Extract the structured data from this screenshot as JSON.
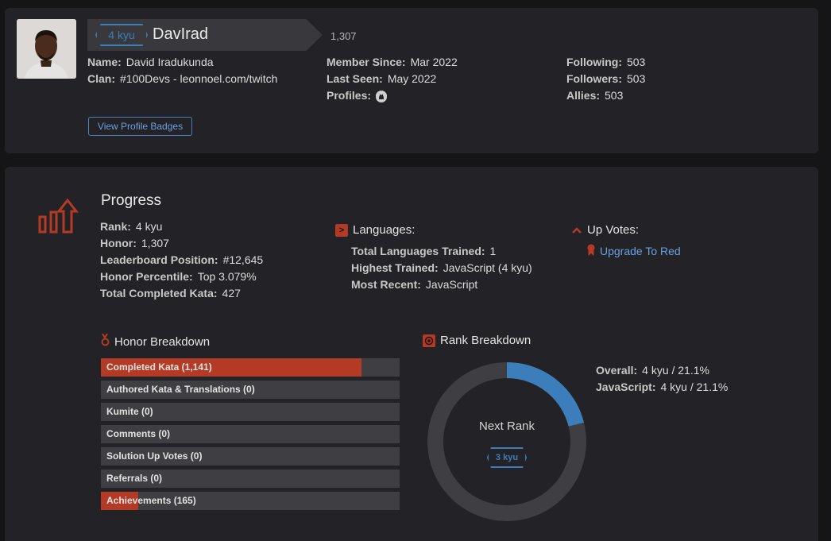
{
  "profile": {
    "rank_badge": "4 kyu",
    "username": "DavIrad",
    "honor": "1,307",
    "name_label": "Name:",
    "name_value": "David Iradukunda",
    "clan_label": "Clan:",
    "clan_value": "#100Devs - leonnoel.com/twitch",
    "member_since_label": "Member Since:",
    "member_since_value": "Mar 2022",
    "last_seen_label": "Last Seen:",
    "last_seen_value": "May 2022",
    "profiles_label": "Profiles:",
    "following_label": "Following:",
    "following_value": "503",
    "followers_label": "Followers:",
    "followers_value": "503",
    "allies_label": "Allies:",
    "allies_value": "503",
    "badges_button": "View Profile Badges"
  },
  "progress": {
    "title": "Progress",
    "rank_label": "Rank:",
    "rank_value": "4 kyu",
    "honor_label": "Honor:",
    "honor_value": "1,307",
    "leaderboard_label": "Leaderboard Position:",
    "leaderboard_value": "#12,645",
    "percentile_label": "Honor Percentile:",
    "percentile_value": "Top 3.079%",
    "kata_label": "Total Completed Kata:",
    "kata_value": "427"
  },
  "languages": {
    "title": "Languages:",
    "total_label": "Total Languages Trained:",
    "total_value": "1",
    "highest_label": "Highest Trained:",
    "highest_value": "JavaScript (4 kyu)",
    "recent_label": "Most Recent:",
    "recent_value": "JavaScript"
  },
  "upvotes": {
    "title": "Up Votes:",
    "link": "Upgrade To Red"
  },
  "honor_breakdown": {
    "title": "Honor Breakdown",
    "bars": [
      {
        "label": "Completed Kata (1,141)",
        "fraction": 0.873
      },
      {
        "label": "Authored Kata & Translations (0)",
        "fraction": 0
      },
      {
        "label": "Kumite (0)",
        "fraction": 0
      },
      {
        "label": "Comments (0)",
        "fraction": 0
      },
      {
        "label": "Solution Up Votes (0)",
        "fraction": 0
      },
      {
        "label": "Referrals (0)",
        "fraction": 0
      },
      {
        "label": "Achievements (165)",
        "fraction": 0.126
      }
    ]
  },
  "rank_breakdown": {
    "title": "Rank Breakdown",
    "progress_fraction": 0.211,
    "next_rank_label": "Next Rank",
    "next_rank_badge": "3 kyu",
    "overall_label": "Overall:",
    "overall_value": "4 kyu / 21.1%",
    "js_label": "JavaScript:",
    "js_value": "4 kyu / 21.1%"
  },
  "colors": {
    "accent_red": "#b33b25",
    "accent_blue": "#3c7ebb",
    "link_blue": "#6a9fe0"
  }
}
